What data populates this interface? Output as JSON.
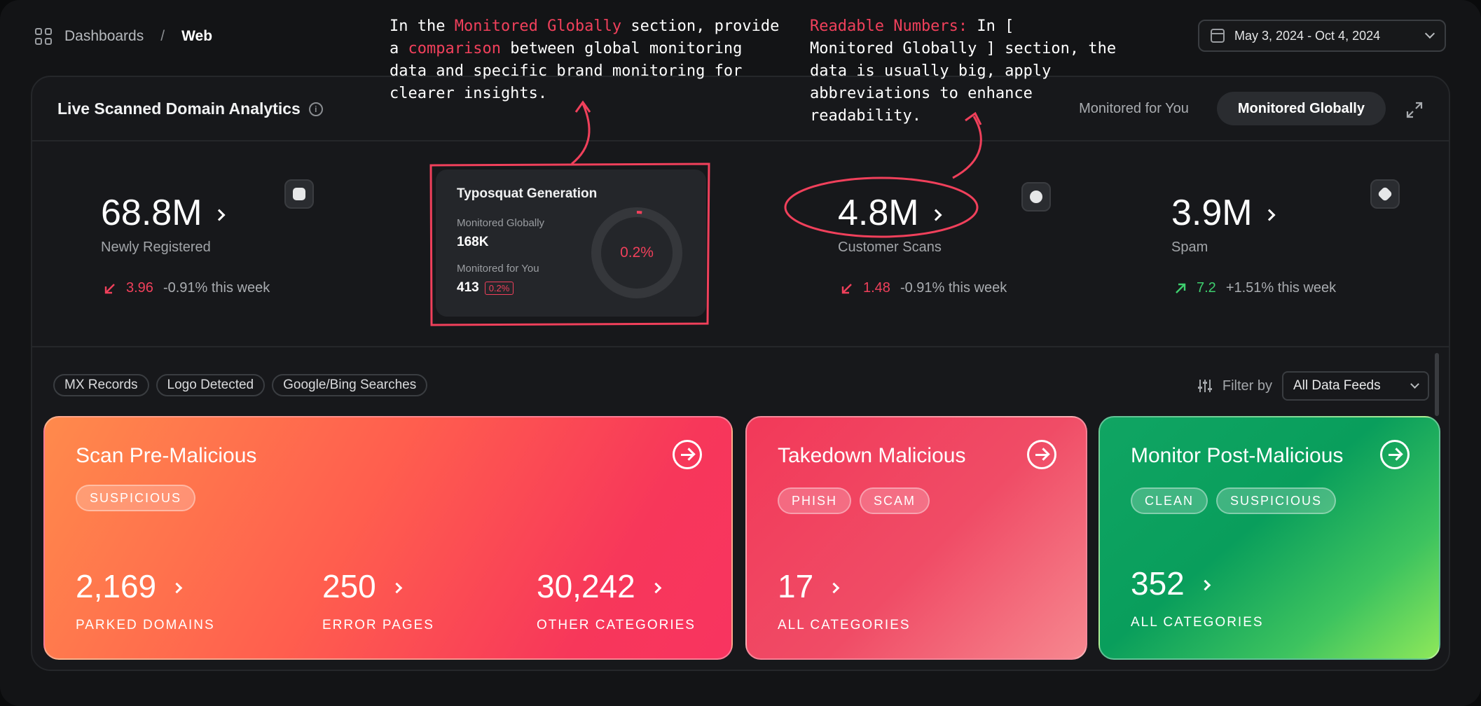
{
  "breadcrumb": {
    "root": "Dashboards",
    "separator": "/",
    "current": "Web"
  },
  "date_range": "May 3, 2024 - Oct 4, 2024",
  "panel": {
    "title": "Live Scanned Domain Analytics",
    "info_glyph": "i",
    "tabs": [
      {
        "label": "Monitored for You",
        "active": false
      },
      {
        "label": "Monitored Globally",
        "active": true
      }
    ]
  },
  "stats": [
    {
      "value": "68.8M",
      "label": "Newly Registered",
      "change_value": "3.96",
      "change_text": "-0.91% this week",
      "direction": "down"
    },
    {
      "value": "4.8M",
      "label": "Customer Scans",
      "change_value": "1.48",
      "change_text": "-0.91% this week",
      "direction": "down"
    },
    {
      "value": "3.9M",
      "label": "Spam",
      "change_value": "7.2",
      "change_text": "+1.51% this week",
      "direction": "up"
    }
  ],
  "typosquat": {
    "title": "Typosquat Generation",
    "global_label": "Monitored Globally",
    "global_value": "168K",
    "you_label": "Monitored for You",
    "you_value": "413",
    "you_percent": "0.2%",
    "ring_label": "0.2%",
    "ring_fraction": 0.02
  },
  "chips": [
    "MX Records",
    "Logo Detected",
    "Google/Bing Searches"
  ],
  "filter": {
    "label": "Filter by",
    "value": "All Data Feeds"
  },
  "cards": {
    "pre": {
      "title": "Scan Pre-Malicious",
      "tags": [
        "SUSPICIOUS"
      ],
      "metrics": [
        {
          "value": "2,169",
          "label": "PARKED DOMAINS"
        },
        {
          "value": "250",
          "label": "ERROR PAGES"
        },
        {
          "value": "30,242",
          "label": "OTHER CATEGORIES"
        }
      ]
    },
    "take": {
      "title": "Takedown Malicious",
      "tags": [
        "PHISH",
        "SCAM"
      ],
      "metrics": [
        {
          "value": "17",
          "label": "ALL CATEGORIES"
        }
      ]
    },
    "post": {
      "title": "Monitor Post-Malicious",
      "tags": [
        "CLEAN",
        "SUSPICIOUS"
      ],
      "metrics": [
        {
          "value": "352",
          "label": "ALL CATEGORIES"
        }
      ]
    }
  },
  "annotations": {
    "left": {
      "l1_a": "In the ",
      "l1_hl": "Monitored Globally",
      "l1_b": " section, provide",
      "l2_a": "a ",
      "l2_hl": "comparison",
      "l2_b": " between global monitoring",
      "l3": "data and specific brand monitoring for",
      "l4": "clearer insights."
    },
    "right": {
      "l1_hl": "Readable Numbers:",
      "l1_b": " In [",
      "l2": "Monitored Globally ] section, the",
      "l3": "data is usually big, apply",
      "l4": "abbreviations to enhance",
      "l5": "readability."
    }
  },
  "colors": {
    "accent_red": "#f0405b",
    "accent_green": "#3ecf6e",
    "background": "#131416"
  }
}
